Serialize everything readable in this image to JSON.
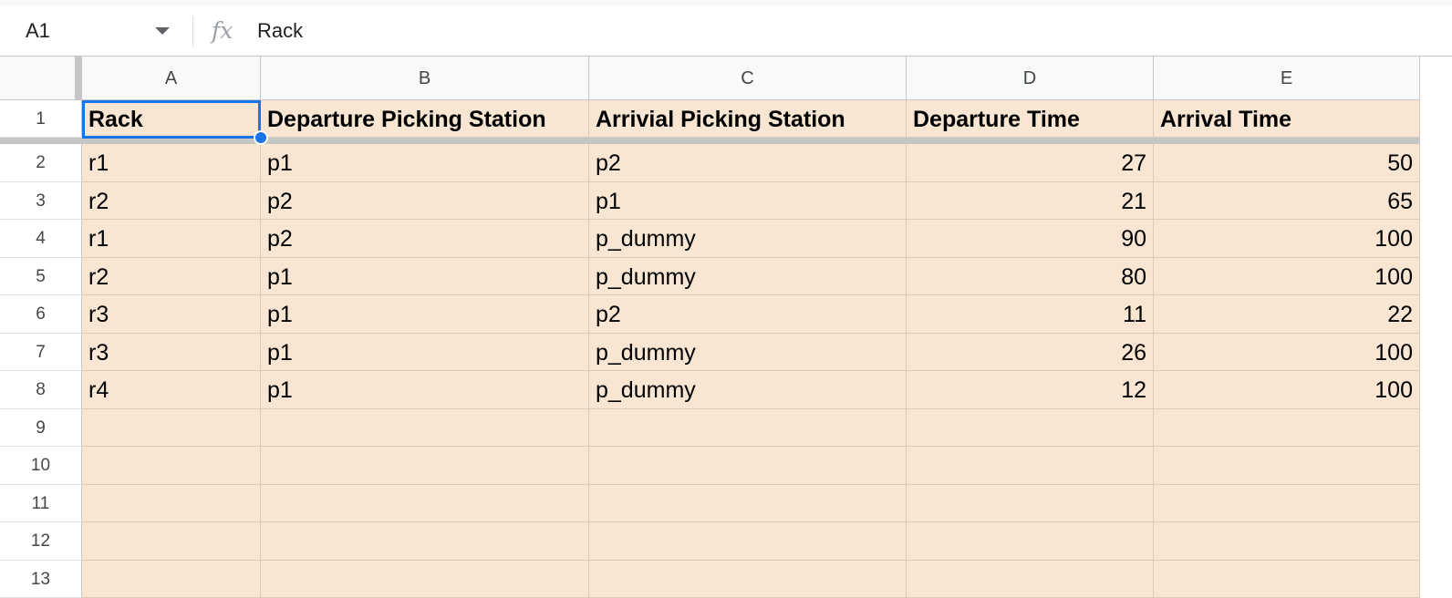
{
  "formula_bar": {
    "name_box": "A1",
    "fx_label": "fx",
    "value": "Rack"
  },
  "sheet": {
    "columns": [
      "A",
      "B",
      "C",
      "D",
      "E"
    ],
    "row_numbers": [
      "1",
      "2",
      "3",
      "4",
      "5",
      "6",
      "7",
      "8",
      "9",
      "10",
      "11",
      "12",
      "13"
    ],
    "header_row": [
      "Rack",
      "Departure Picking Station",
      "Arrivial Picking Station",
      "Departure Time",
      "Arrival Time"
    ],
    "rows": [
      [
        "r1",
        "p1",
        "p2",
        "27",
        "50"
      ],
      [
        "r2",
        "p2",
        "p1",
        "21",
        "65"
      ],
      [
        "r1",
        "p2",
        "p_dummy",
        "90",
        "100"
      ],
      [
        "r2",
        "p1",
        "p_dummy",
        "80",
        "100"
      ],
      [
        "r3",
        "p1",
        "p2",
        "11",
        "22"
      ],
      [
        "r3",
        "p1",
        "p_dummy",
        "26",
        "100"
      ],
      [
        "r4",
        "p1",
        "p_dummy",
        "12",
        "100"
      ],
      [
        "",
        "",
        "",
        "",
        ""
      ],
      [
        "",
        "",
        "",
        "",
        ""
      ],
      [
        "",
        "",
        "",
        "",
        ""
      ],
      [
        "",
        "",
        "",
        "",
        ""
      ],
      [
        "",
        "",
        "",
        "",
        ""
      ]
    ],
    "selected_cell": "A1",
    "cell_fill_color": "#f8e6d3",
    "selection_color": "#1a73e8"
  }
}
